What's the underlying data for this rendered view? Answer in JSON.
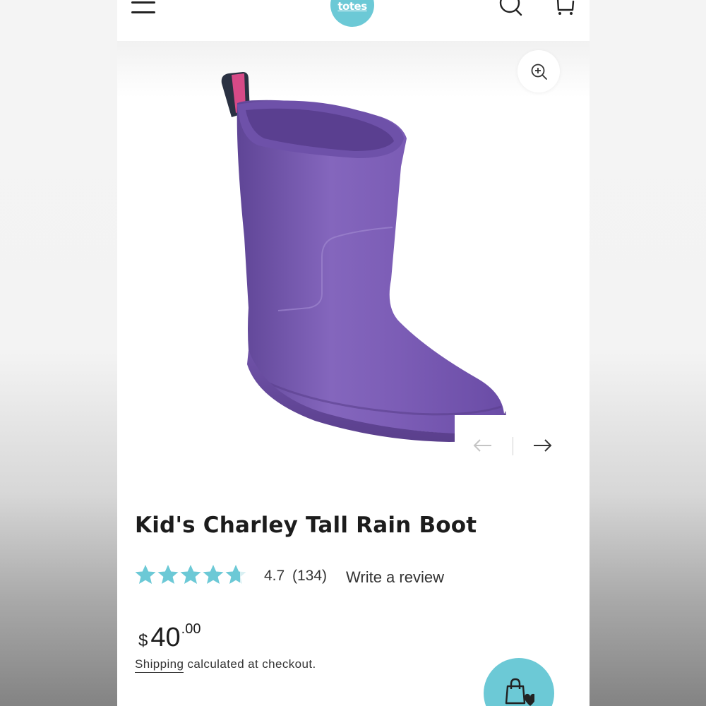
{
  "header": {
    "logo_text": "totes",
    "icons": [
      "menu-icon",
      "search-icon",
      "cart-icon"
    ]
  },
  "product": {
    "title": "Kid's Charley Tall Rain Boot",
    "image_icons": [
      "zoom-in-icon",
      "arrow-left-icon",
      "arrow-right-icon"
    ]
  },
  "rating": {
    "value": "4.7",
    "count": "(134)",
    "stars_filled": 4.7,
    "stars_total": 5,
    "write_review_label": "Write a review"
  },
  "price": {
    "currency": "$",
    "main": "40",
    "cents": ".00"
  },
  "shipping": {
    "link_label": "Shipping",
    "note": " calculated at checkout."
  },
  "colors": {
    "brand_accent": "#6cc9d6",
    "boot_purple": "#7b5bb0",
    "text_dark": "#1c1c1c"
  }
}
